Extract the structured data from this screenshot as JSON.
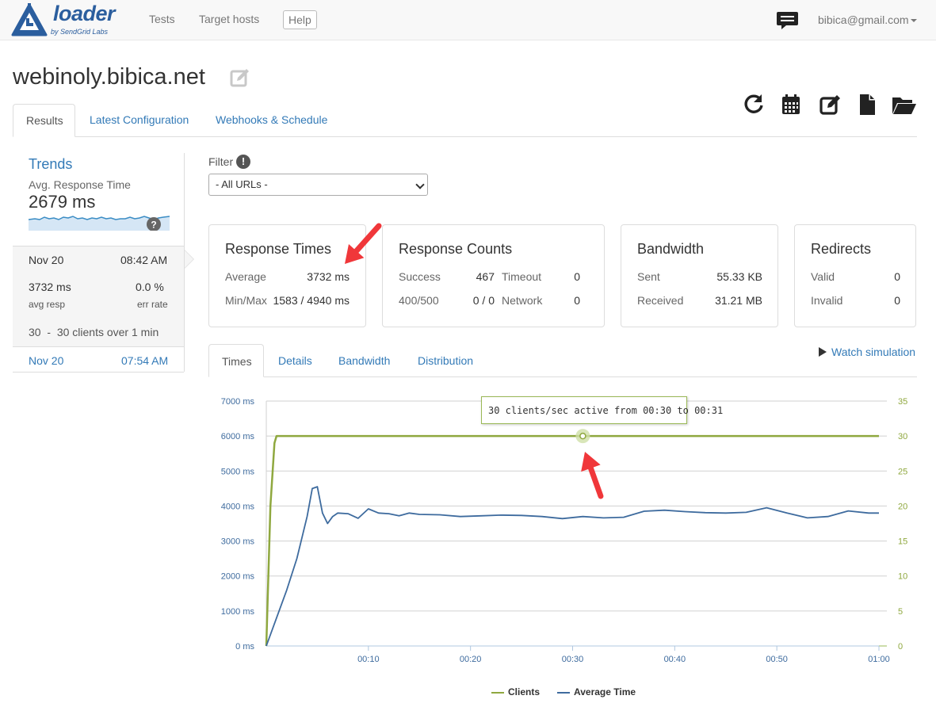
{
  "nav": {
    "brand": "loader",
    "brand_sub": "by SendGrid Labs",
    "links": [
      "Tests",
      "Target hosts"
    ],
    "help": "Help",
    "user": "bibica@gmail.com"
  },
  "page": {
    "title": "webinoly.bibica.net"
  },
  "tabs": [
    "Results",
    "Latest Configuration",
    "Webhooks & Schedule"
  ],
  "trends": {
    "title": "Trends",
    "metric_label": "Avg. Response Time",
    "metric_value": "2679 ms",
    "help": "?",
    "runs": [
      {
        "date": "Nov 20",
        "time": "08:42 AM",
        "avg_resp": "3732 ms",
        "avg_resp_label": "avg resp",
        "err_rate": "0.0 %",
        "err_rate_label": "err rate",
        "clients_from": "30",
        "clients_to": "30",
        "clients_text": "clients over",
        "duration_value": "1",
        "duration_unit": "min"
      },
      {
        "date": "Nov 20",
        "time": "07:54 AM"
      }
    ]
  },
  "filter": {
    "label": "Filter",
    "info": "!",
    "selected": "- All URLs -"
  },
  "cards": {
    "response_times": {
      "title": "Response Times",
      "average_label": "Average",
      "average_value": "3732 ms",
      "minmax_label": "Min/Max",
      "minmax_value": "1583 / 4940 ms"
    },
    "response_counts": {
      "title": "Response Counts",
      "success_label": "Success",
      "success_value": "467",
      "timeout_label": "Timeout",
      "timeout_value": "0",
      "err_label": "400/500",
      "err_value": "0 / 0",
      "network_label": "Network",
      "network_value": "0"
    },
    "bandwidth": {
      "title": "Bandwidth",
      "sent_label": "Sent",
      "sent_value": "55.33 KB",
      "received_label": "Received",
      "received_value": "31.21 MB"
    },
    "redirects": {
      "title": "Redirects",
      "valid_label": "Valid",
      "valid_value": "0",
      "invalid_label": "Invalid",
      "invalid_value": "0"
    }
  },
  "subtabs": [
    "Times",
    "Details",
    "Bandwidth",
    "Distribution"
  ],
  "watch_simulation": "Watch simulation",
  "tooltip": "30 clients/sec active from 00:30 to 00:31",
  "colors": {
    "clients": "#8fa83f",
    "average_time": "#3e6b9e",
    "link": "#337ab7",
    "arrow": "#f0373a"
  },
  "chart_data": {
    "type": "line",
    "x_unit": "seconds",
    "x_ticks": [
      "00:10",
      "00:20",
      "00:30",
      "00:40",
      "00:50",
      "01:00"
    ],
    "y_left_ticks": [
      "0 ms",
      "1000 ms",
      "2000 ms",
      "3000 ms",
      "4000 ms",
      "5000 ms",
      "6000 ms",
      "7000 ms"
    ],
    "y_right_ticks": [
      "0",
      "5",
      "10",
      "15",
      "20",
      "25",
      "30",
      "35"
    ],
    "ylim_left": [
      0,
      7000
    ],
    "ylim_right": [
      0,
      35
    ],
    "xlim": [
      0,
      60
    ],
    "grid": true,
    "legend": "bottom-center",
    "series": [
      {
        "name": "Clients",
        "axis": "right",
        "x": [
          0,
          0.4,
          0.8,
          1.0,
          60
        ],
        "y": [
          0,
          20,
          29,
          30,
          30
        ]
      },
      {
        "name": "Average Time",
        "axis": "left",
        "x": [
          0,
          1,
          2,
          3,
          4,
          4.5,
          5,
          5.5,
          6,
          6.5,
          7,
          8,
          9,
          10,
          11,
          12,
          13,
          14,
          15,
          17,
          19,
          21,
          23,
          25,
          27,
          29,
          31,
          33,
          35,
          37,
          39,
          41,
          43,
          45,
          47,
          49,
          51,
          53,
          55,
          57,
          59,
          60
        ],
        "y": [
          0,
          800,
          1600,
          2500,
          3700,
          4500,
          4550,
          3800,
          3500,
          3700,
          3800,
          3780,
          3650,
          3920,
          3800,
          3780,
          3720,
          3800,
          3760,
          3750,
          3700,
          3720,
          3740,
          3730,
          3700,
          3640,
          3700,
          3660,
          3680,
          3850,
          3880,
          3840,
          3810,
          3800,
          3820,
          3950,
          3800,
          3660,
          3700,
          3860,
          3800,
          3800
        ]
      }
    ]
  }
}
